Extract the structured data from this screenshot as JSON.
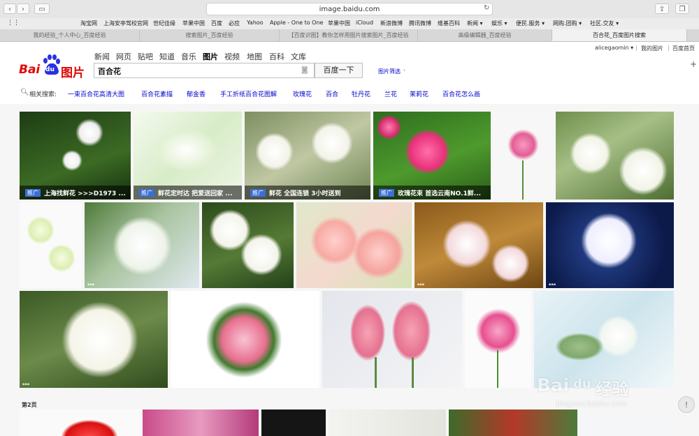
{
  "browser": {
    "url": "image.baidu.com",
    "favorites": [
      "淘宝网",
      "上海安亭驾校官网",
      "世纪佳缘",
      "苹果中国",
      "百度",
      "必应",
      "Yahoo",
      "Apple - One to One",
      "苹果中国",
      "iCloud",
      "新浪微博",
      "腾讯微博",
      "维基百科",
      "新闻 ▾",
      "娱乐 ▾",
      "便民.服务 ▾",
      "网购.团购 ▾",
      "社区.交友 ▾"
    ],
    "tabs": [
      "我的经验_个人中心_百度经验",
      "搜索图片_百度经验",
      "【百度识图】教你怎样用图片搜索图片_百度经验",
      "高级编辑器_百度经验",
      "百合花_百度图片搜索"
    ]
  },
  "header": {
    "logo_text": "Bai",
    "logo_du": "du",
    "logo_suffix": "图片",
    "nav": [
      "新闻",
      "网页",
      "贴吧",
      "知道",
      "音乐",
      "图片",
      "视频",
      "地图",
      "百科",
      "文库"
    ],
    "user": "alicegaomin ▾",
    "my_images": "我的图片",
    "homepage": "百度首页"
  },
  "search": {
    "query": "百合花",
    "button": "百度一下",
    "filter": "图片筛选"
  },
  "related": {
    "label": "相关搜索:",
    "items": [
      "一束百合花高清大图",
      "百合花素描",
      "郁金香",
      "手工折纸百合花图解",
      "玫瑰花",
      "百合",
      "牡丹花",
      "兰花",
      "茉莉花",
      "百合花怎么画"
    ]
  },
  "ads": [
    {
      "tag": "推广",
      "text": "上海找鲜花 >>>D1973 ..."
    },
    {
      "tag": "推广",
      "text": "鲜花定时达 把爱送回家 ..."
    },
    {
      "tag": "推广",
      "text": "鲜花 全国连锁 3小时送到"
    },
    {
      "tag": "推广",
      "text": "玫瑰花束 首选云南NO.1鲜..."
    }
  ],
  "page2": "第2页",
  "watermark": {
    "brand": "Bai",
    "paw": "du",
    "brand_cn": "经验",
    "url": "jingyan.baidu.com"
  },
  "colors": {
    "baidu_red": "#e10602",
    "baidu_blue": "#2932e1",
    "link_blue": "#0000cc"
  }
}
